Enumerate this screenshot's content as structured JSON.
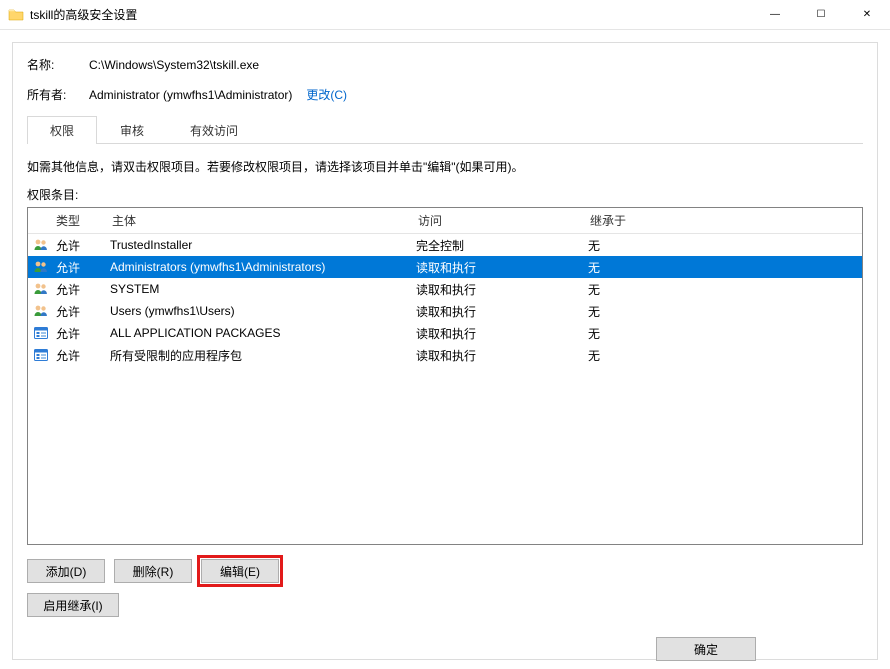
{
  "window": {
    "title": "tskill的高级安全设置",
    "controls": {
      "min": "—",
      "max": "☐",
      "close": "✕"
    }
  },
  "fields": {
    "name_label": "名称:",
    "name_value": "C:\\Windows\\System32\\tskill.exe",
    "owner_label": "所有者:",
    "owner_value": "Administrator (ymwfhs1\\Administrator)",
    "change_link": "更改(C)"
  },
  "tabs": {
    "perm": "权限",
    "audit": "审核",
    "effective": "有效访问"
  },
  "instruction": "如需其他信息，请双击权限项目。若要修改权限项目，请选择该项目并单击\"编辑\"(如果可用)。",
  "list_label": "权限条目:",
  "columns": {
    "type": "类型",
    "principal": "主体",
    "access": "访问",
    "inherit": "继承于"
  },
  "rows": [
    {
      "icon": "users",
      "type": "允许",
      "principal": "TrustedInstaller",
      "access": "完全控制",
      "inherit": "无",
      "selected": false
    },
    {
      "icon": "users",
      "type": "允许",
      "principal": "Administrators (ymwfhs1\\Administrators)",
      "access": "读取和执行",
      "inherit": "无",
      "selected": true
    },
    {
      "icon": "users",
      "type": "允许",
      "principal": "SYSTEM",
      "access": "读取和执行",
      "inherit": "无",
      "selected": false
    },
    {
      "icon": "users",
      "type": "允许",
      "principal": "Users (ymwfhs1\\Users)",
      "access": "读取和执行",
      "inherit": "无",
      "selected": false
    },
    {
      "icon": "pkg",
      "type": "允许",
      "principal": "ALL APPLICATION PACKAGES",
      "access": "读取和执行",
      "inherit": "无",
      "selected": false
    },
    {
      "icon": "pkg",
      "type": "允许",
      "principal": "所有受限制的应用程序包",
      "access": "读取和执行",
      "inherit": "无",
      "selected": false
    }
  ],
  "buttons": {
    "add": "添加(D)",
    "remove": "删除(R)",
    "edit": "编辑(E)",
    "enable_inherit": "启用继承(I)",
    "ok": "确定"
  }
}
